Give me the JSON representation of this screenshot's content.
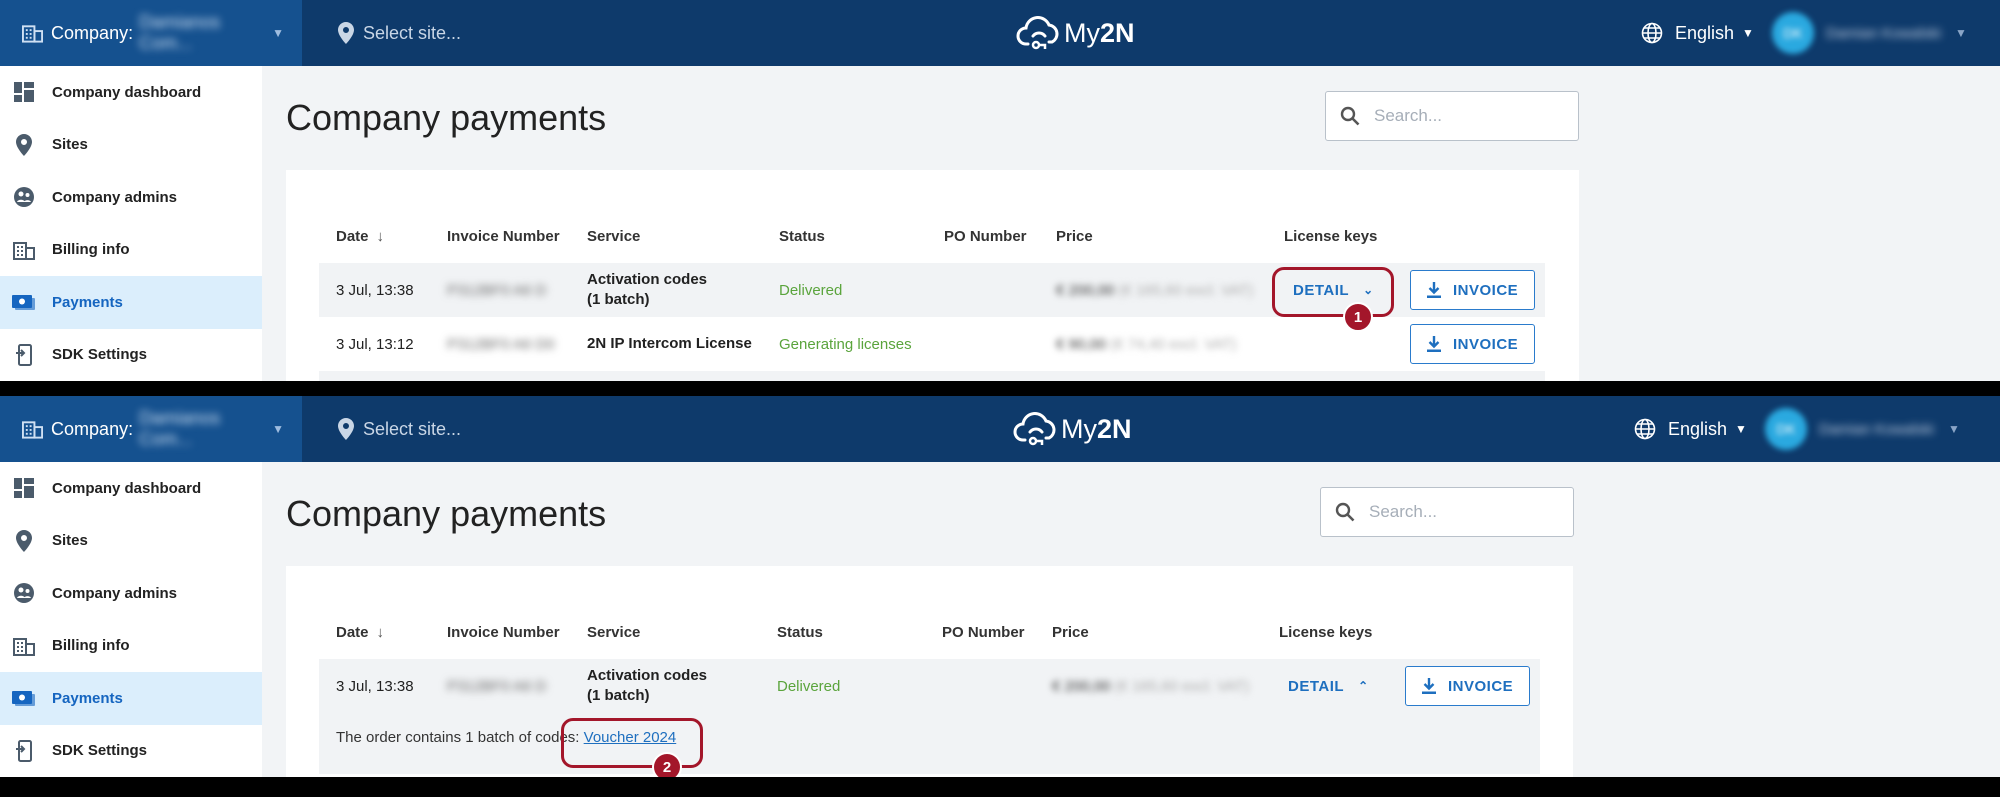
{
  "topbar": {
    "company_label": "Company:",
    "company_name": "Damianos Com...",
    "site_placeholder": "Select site...",
    "logo_text_my": "My",
    "logo_text_2n": "2N",
    "language": "English",
    "user_initials": "DK",
    "user_name": "Damian Kowalski"
  },
  "sidebar": {
    "items": [
      {
        "label": "Company dashboard",
        "icon": "dashboard-icon"
      },
      {
        "label": "Sites",
        "icon": "location-pin-icon"
      },
      {
        "label": "Company admins",
        "icon": "globe-people-icon"
      },
      {
        "label": "Billing info",
        "icon": "building-icon"
      },
      {
        "label": "Payments",
        "icon": "payments-icon",
        "active": true
      },
      {
        "label": "SDK Settings",
        "icon": "sdk-icon"
      }
    ]
  },
  "page": {
    "title": "Company payments",
    "search_placeholder": "Search..."
  },
  "table": {
    "headers": [
      "Date",
      "Invoice Number",
      "Service",
      "Status",
      "PO Number",
      "Price",
      "License keys"
    ],
    "rows": [
      {
        "date": "3 Jul, 13:38",
        "invoice_number": "P312BF0 A6 D",
        "service_line1": "Activation codes",
        "service_line2": "(1 batch)",
        "status": "Delivered",
        "price": "€ 200,00",
        "price_ex": "(€ 165,60 excl. VAT)",
        "license_action": "DETAIL",
        "invoice_action": "INVOICE"
      },
      {
        "date": "3 Jul, 13:12",
        "invoice_number": "P312BF0 A6 D0",
        "service_line1": "2N IP Intercom License",
        "status": "Generating licenses",
        "price": "€ 90,00",
        "price_ex": "(€ 74,40 excl. VAT)",
        "invoice_action": "INVOICE"
      }
    ]
  },
  "expanded": {
    "note_prefix": "The order contains 1 batch of codes:",
    "link_text": "Voucher 2024"
  },
  "annotations": {
    "step1": "1",
    "step2": "2"
  },
  "colors": {
    "topbar": "#0e3a6b",
    "company_bar": "#15518f",
    "accent": "#1e6fbf",
    "highlight": "#a3162a",
    "delivered": "#5aa43c"
  }
}
